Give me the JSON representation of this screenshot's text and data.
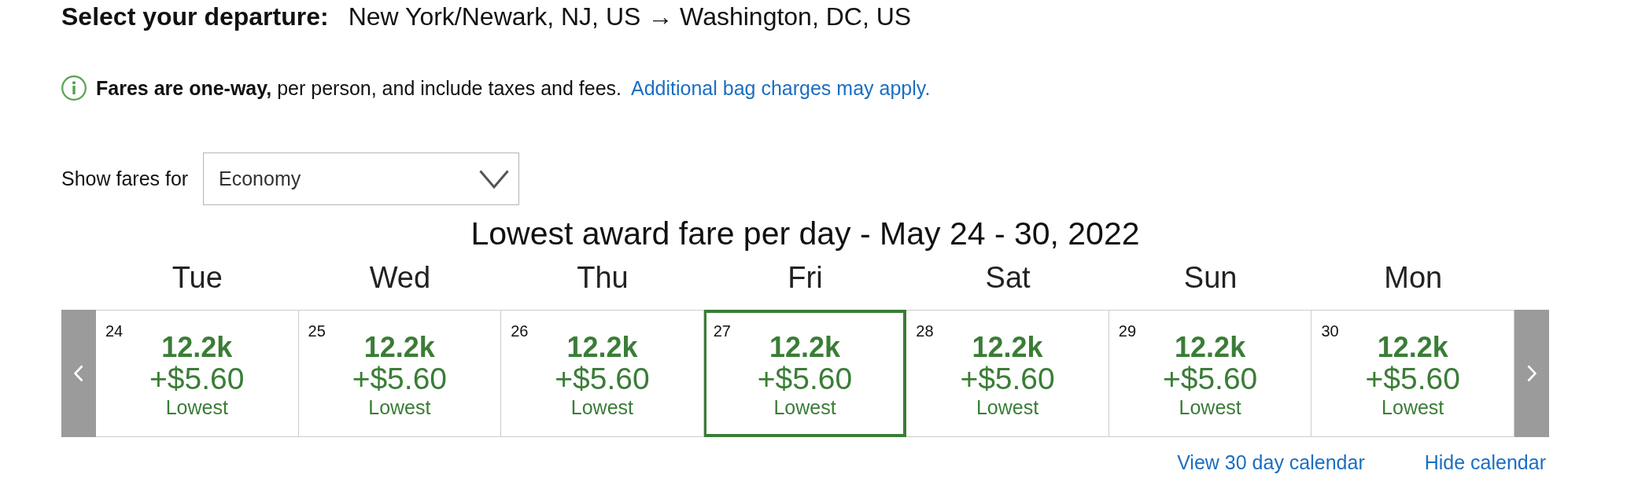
{
  "header": {
    "label": "Select your departure:",
    "route": "New York/Newark, NJ, US → Washington, DC, US"
  },
  "notice": {
    "text": "**Fares are one-way,** per person, and include taxes and fees.",
    "link": "Additional bag charges may apply."
  },
  "fare_filter": {
    "label": "Show fares for",
    "value": "Economy"
  },
  "calendar": {
    "title": "Lowest award fare per day - May 24 - 30, 2022",
    "days": [
      {
        "weekday": "Tue",
        "date": "24",
        "miles": "12.2k",
        "taxes": "+$5.60",
        "tag": "Lowest",
        "selected": false
      },
      {
        "weekday": "Wed",
        "date": "25",
        "miles": "12.2k",
        "taxes": "+$5.60",
        "tag": "Lowest",
        "selected": false
      },
      {
        "weekday": "Thu",
        "date": "26",
        "miles": "12.2k",
        "taxes": "+$5.60",
        "tag": "Lowest",
        "selected": false
      },
      {
        "weekday": "Fri",
        "date": "27",
        "miles": "12.2k",
        "taxes": "+$5.60",
        "tag": "Lowest",
        "selected": true
      },
      {
        "weekday": "Sat",
        "date": "28",
        "miles": "12.2k",
        "taxes": "+$5.60",
        "tag": "Lowest",
        "selected": false
      },
      {
        "weekday": "Sun",
        "date": "29",
        "miles": "12.2k",
        "taxes": "+$5.60",
        "tag": "Lowest",
        "selected": false
      },
      {
        "weekday": "Mon",
        "date": "30",
        "miles": "12.2k",
        "taxes": "+$5.60",
        "tag": "Lowest",
        "selected": false
      }
    ],
    "links": [
      "View 30 day calendar",
      "Hide calendar"
    ]
  }
}
